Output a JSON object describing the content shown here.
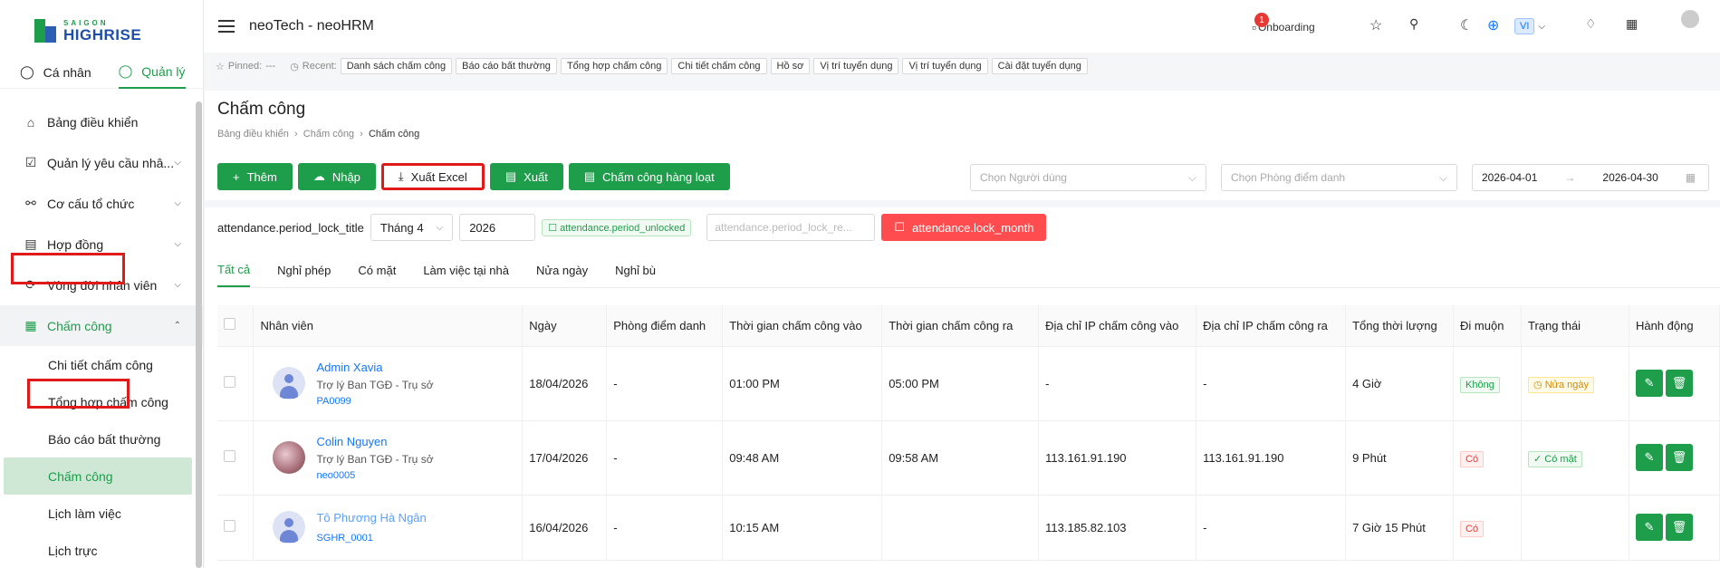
{
  "logo": {
    "line1": "SAIGON",
    "line2": "HIGHRISE"
  },
  "role_tabs": [
    {
      "label": "Cá nhân"
    },
    {
      "label": "Quản lý"
    }
  ],
  "sidebar": {
    "items": [
      {
        "label": "Bảng điều khiển"
      },
      {
        "label": "Quản lý yêu cầu nhâ..."
      },
      {
        "label": "Cơ cấu tổ chức"
      },
      {
        "label": "Hợp đồng"
      },
      {
        "label": "Vòng đời nhân viên"
      },
      {
        "label": "Chấm công"
      }
    ],
    "sub_items": [
      {
        "label": "Chi tiết chấm công"
      },
      {
        "label": "Tổng hợp chấm công"
      },
      {
        "label": "Báo cáo bất thường"
      },
      {
        "label": "Chấm công"
      },
      {
        "label": "Lịch làm việc"
      },
      {
        "label": "Lịch trực"
      }
    ]
  },
  "header": {
    "title": "neoTech - neoHRM",
    "onboarding_label": "Onboarding",
    "onboarding_count": "1",
    "lang": "VI"
  },
  "pinbar": {
    "pinned_label": "Pinned:",
    "pinned_value": "---",
    "recent_label": "Recent:",
    "recent": [
      "Danh sách chấm công",
      "Báo cáo bất thường",
      "Tổng hợp chấm công",
      "Chi tiết chấm công",
      "Hồ sơ",
      "Vị trí tuyển dụng",
      "Vị trí tuyển dụng",
      "Cài đặt tuyển dụng"
    ]
  },
  "page": {
    "title": "Chấm công",
    "breadcrumb": [
      "Bảng điều khiển",
      "Chấm công",
      "Chấm công"
    ]
  },
  "toolbar": {
    "add": "Thêm",
    "import": "Nhập",
    "export_excel": "Xuất Excel",
    "export": "Xuất",
    "bulk": "Chấm công hàng loạt",
    "user_placeholder": "Chọn Người dùng",
    "room_placeholder": "Chọn Phòng điểm danh",
    "date_from": "2026-04-01",
    "date_to": "2026-04-30"
  },
  "lock": {
    "title": "attendance.period_lock_title",
    "month": "Tháng 4",
    "year": "2026",
    "status": "attendance.period_unlocked",
    "reason_placeholder": "attendance.period_lock_re...",
    "lock_button": "attendance.lock_month"
  },
  "tabs": [
    {
      "label": "Tất cả"
    },
    {
      "label": "Nghỉ phép"
    },
    {
      "label": "Có mặt"
    },
    {
      "label": "Làm việc tại nhà"
    },
    {
      "label": "Nửa ngày"
    },
    {
      "label": "Nghỉ bù"
    }
  ],
  "table": {
    "headers": [
      "Nhân viên",
      "Ngày",
      "Phòng điểm danh",
      "Thời gian chấm công vào",
      "Thời gian chấm công ra",
      "Địa chỉ IP chấm công vào",
      "Địa chỉ IP chấm công ra",
      "Tổng thời lượng",
      "Đi muộn",
      "Trạng thái",
      "Hành động"
    ],
    "rows": [
      {
        "name": "Admin Xavia",
        "role": "Trợ lý Ban TGĐ - Trụ sở",
        "code": "PA0099",
        "date": "18/04/2026",
        "room": "-",
        "in": "01:00 PM",
        "out": "05:00 PM",
        "ip_in": "-",
        "ip_out": "-",
        "duration": "4 Giờ",
        "late": "Không",
        "status": "Nửa ngày"
      },
      {
        "name": "Colin Nguyen",
        "role": "Trợ lý Ban TGĐ - Trụ sở",
        "code": "neo0005",
        "date": "17/04/2026",
        "room": "-",
        "in": "09:48 AM",
        "out": "09:58 AM",
        "ip_in": "113.161.91.190",
        "ip_out": "113.161.91.190",
        "duration": "9 Phút",
        "late": "Có",
        "status": "Có mặt"
      },
      {
        "name": "Tô Phương Hà Ngân",
        "role": "",
        "code": "SGHR_0001",
        "date": "16/04/2026",
        "room": "-",
        "in": "10:15 AM",
        "out": "",
        "ip_in": "113.185.82.103",
        "ip_out": "-",
        "duration": "7 Giờ 15 Phút",
        "late": "Có",
        "status": ""
      }
    ]
  }
}
